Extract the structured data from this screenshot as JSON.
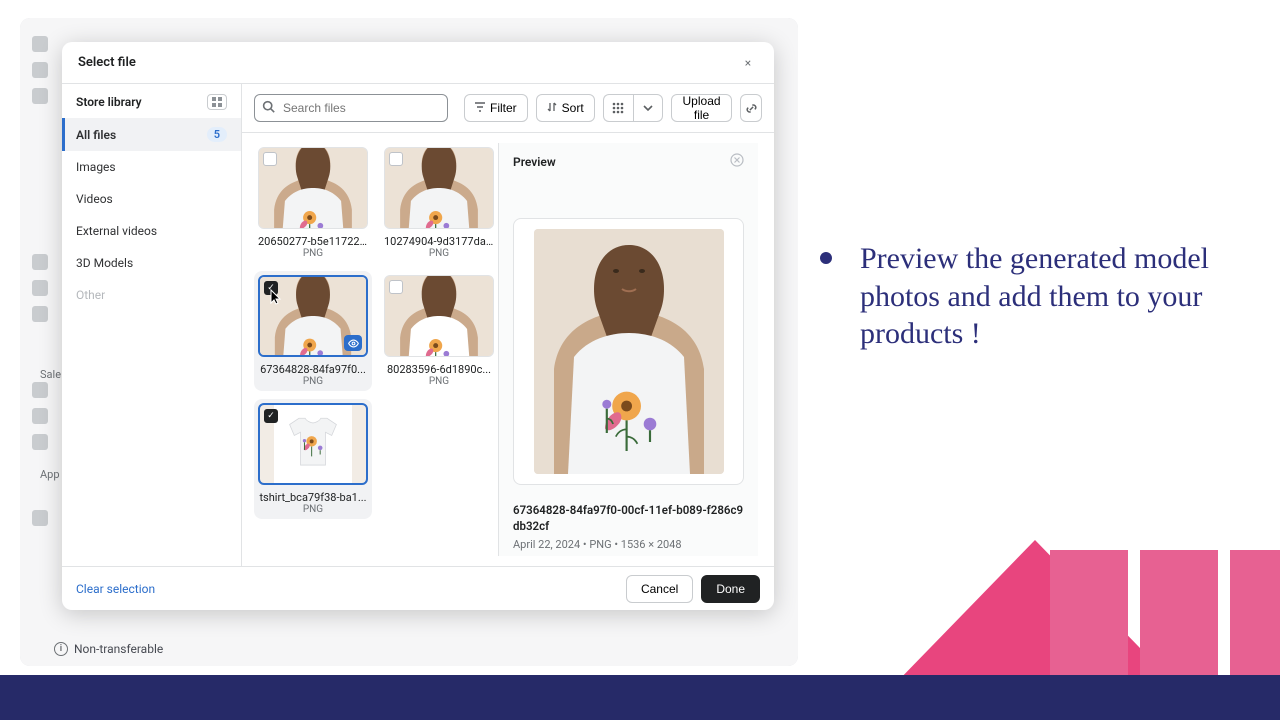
{
  "promo": {
    "text": "Preview the generated model photos and add them to your products !"
  },
  "app_shell": {
    "sales_label": "Sale",
    "apps_label": "App",
    "non_transferable": "Non-transferable"
  },
  "modal": {
    "title": "Select file",
    "close": "×",
    "sidebar": {
      "heading": "Store library",
      "items": [
        {
          "label": "All files",
          "count": "5",
          "active": true
        },
        {
          "label": "Images"
        },
        {
          "label": "Videos"
        },
        {
          "label": "External videos"
        },
        {
          "label": "3D Models"
        },
        {
          "label": "Other",
          "disabled": true
        }
      ]
    },
    "toolbar": {
      "search_placeholder": "Search files",
      "filter": "Filter",
      "sort": "Sort",
      "upload": "Upload file"
    },
    "files": [
      {
        "name": "20650277-b5e11722...",
        "type": "PNG",
        "checked": false,
        "style": "model"
      },
      {
        "name": "10274904-9d3177da...",
        "type": "PNG",
        "checked": false,
        "style": "model"
      },
      {
        "name": "67364828-84fa97f0...",
        "type": "PNG",
        "checked": true,
        "style": "model",
        "selected": true,
        "eye": true,
        "cursor": true
      },
      {
        "name": "80283596-6d1890c...",
        "type": "PNG",
        "checked": false,
        "style": "model-pink"
      },
      {
        "name": "tshirt_bca79f38-ba1...",
        "type": "PNG",
        "checked": true,
        "style": "flat",
        "selected": true
      }
    ],
    "preview": {
      "label": "Preview",
      "filename": "67364828-84fa97f0-00cf-11ef-b089-f286c9db32cf",
      "meta": "April 22, 2024 • PNG • 1536 × 2048"
    },
    "footer": {
      "clear": "Clear selection",
      "cancel": "Cancel",
      "done": "Done"
    }
  }
}
